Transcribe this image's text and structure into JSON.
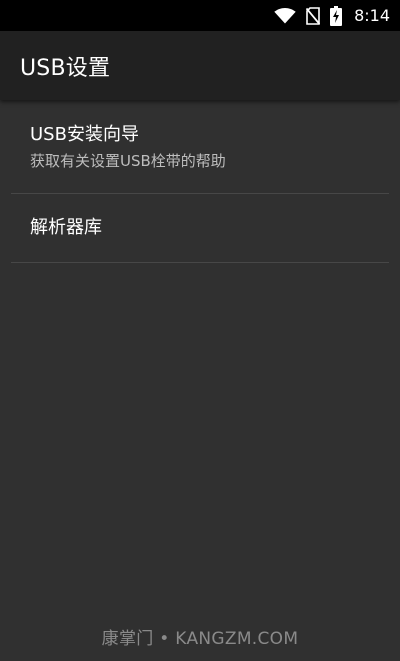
{
  "status_bar": {
    "time": "8:14",
    "icons": [
      "wifi-icon",
      "no-sim-icon",
      "battery-charging-icon"
    ]
  },
  "app_bar": {
    "title": "USB设置"
  },
  "preferences": [
    {
      "title": "USB安装向导",
      "summary": "获取有关设置USB栓带的帮助"
    },
    {
      "title": "解析器库"
    }
  ],
  "watermark": "康掌门 • KANGZM.COM",
  "colors": {
    "status_bar_bg": "#000000",
    "app_bar_bg": "#212121",
    "background": "#303030",
    "divider": "#474747",
    "primary_text": "#ffffff",
    "secondary_text": "#bdbdbd"
  }
}
